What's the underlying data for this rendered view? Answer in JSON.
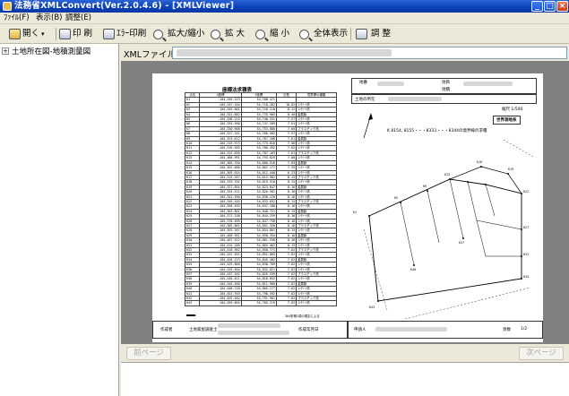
{
  "window": {
    "title": "法務省XMLConvert(Ver.2.0.4.6) - [XMLViewer]",
    "controls": {
      "minimize": "_",
      "maximize": "□",
      "close": "×"
    }
  },
  "menu": {
    "items": [
      {
        "label": "ﾌｧｲﾙ(F)"
      },
      {
        "label": "表示(B)"
      },
      {
        "label": "調整(E)"
      }
    ]
  },
  "toolbar": {
    "open_label": "開く",
    "print_label": "印 刷",
    "error_print_label": "ｴﾗｰ印刷",
    "zoom_toggle_label": "拡大/縮小",
    "zoom_in_label": "拡 大",
    "zoom_out_label": "縮 小",
    "fit_label": "全体表示",
    "adjust_label": "調 整"
  },
  "tree": {
    "root_label": "土地所在図-地積測量図"
  },
  "xml_file": {
    "label": "XMLファイル"
  },
  "document": {
    "table_title": "座標法求積表",
    "table_headers": [
      "点名",
      "X座標",
      "Y座標",
      "辺長",
      "境界標の種類"
    ],
    "table_rows": [
      [
        "K1",
        "-104,349.223",
        "34,708.471",
        "",
        ""
      ],
      [
        "K2",
        "-104,347.104",
        "34,718.262",
        "10.02",
        "ｺﾝｸﾘｰﾄ杭"
      ],
      [
        "K3",
        "-104,345.001",
        "34,726.110",
        "8.12",
        "ｺﾝｸﾘｰﾄ杭"
      ],
      [
        "K4",
        "-104,341.882",
        "34,733.905",
        "8.40",
        "金属鋲"
      ],
      [
        "K5",
        "-104,338.214",
        "34,740.531",
        "7.57",
        "ｺﾝｸﾘｰﾄ杭"
      ],
      [
        "K6",
        "-104,334.560",
        "34,747.209",
        "7.61",
        "ｺﾝｸﾘｰﾄ杭"
      ],
      [
        "K7",
        "-104,330.908",
        "34,753.880",
        "7.60",
        "プラスチック杭"
      ],
      [
        "K8",
        "-104,327.241",
        "34,760.502",
        "7.57",
        "ｺﾝｸﾘｰﾄ杭"
      ],
      [
        "K9",
        "-104,323.612",
        "34,767.188",
        "7.61",
        "金属鋲"
      ],
      [
        "K10",
        "-104,319.973",
        "34,773.816",
        "7.56",
        "ｺﾝｸﾘｰﾄ杭"
      ],
      [
        "K11",
        "-104,316.305",
        "34,780.492",
        "7.62",
        "ｺﾝｸﾘｰﾄ杭"
      ],
      [
        "K12",
        "-104,312.650",
        "34,787.163",
        "7.61",
        "プラスチック杭"
      ],
      [
        "K13",
        "-104,308.991",
        "34,793.829",
        "7.60",
        "ｺﾝｸﾘｰﾄ杭"
      ],
      [
        "K14",
        "-104,305.320",
        "34,800.516",
        "7.63",
        "金属鋲"
      ],
      [
        "K15",
        "-104,301.688",
        "34,807.177",
        "7.59",
        "ｺﾝｸﾘｰﾄ杭"
      ],
      [
        "K16",
        "-104,305.014",
        "34,812.440",
        "6.23",
        "ｺﾝｸﾘｰﾄ杭"
      ],
      [
        "K17",
        "-104,312.357",
        "34,815.982",
        "8.15",
        "プラスチック杭"
      ],
      [
        "K18",
        "-104,319.702",
        "34,819.510",
        "8.15",
        "ｺﾝｸﾘｰﾄ杭"
      ],
      [
        "K19",
        "-104,327.054",
        "34,823.047",
        "8.16",
        "金属鋲"
      ],
      [
        "K20",
        "-104,334.411",
        "34,826.581",
        "8.16",
        "ｺﾝｸﾘｰﾄ杭"
      ],
      [
        "K21",
        "-104,341.760",
        "34,830.120",
        "8.16",
        "ｺﾝｸﾘｰﾄ杭"
      ],
      [
        "K22",
        "-104,349.103",
        "34,833.652",
        "8.15",
        "プラスチック杭"
      ],
      [
        "K23",
        "-104,356.459",
        "34,837.186",
        "8.16",
        "ｺﾝｸﾘｰﾄ杭"
      ],
      [
        "K24",
        "-104,363.801",
        "34,840.721",
        "8.15",
        "金属鋲"
      ],
      [
        "K25",
        "-104,371.158",
        "34,844.259",
        "8.16",
        "ｺﾝｸﾘｰﾄ杭"
      ],
      [
        "K26",
        "-104,378.509",
        "34,847.790",
        "8.16",
        "ｺﾝｸﾘｰﾄ杭"
      ],
      [
        "K27",
        "-104,385.862",
        "34,851.328",
        "8.16",
        "プラスチック杭"
      ],
      [
        "K28",
        "-104,393.207",
        "34,854.861",
        "8.15",
        "ｺﾝｸﾘｰﾄ杭"
      ],
      [
        "K29",
        "-104,400.561",
        "34,858.394",
        "8.16",
        "金属鋲"
      ],
      [
        "K30",
        "-104,407.912",
        "34,861.930",
        "8.16",
        "ｺﾝｸﾘｰﾄ杭"
      ],
      [
        "K31",
        "-104,415.260",
        "34,865.462",
        "8.15",
        "ｺﾝｸﾘｰﾄ杭"
      ],
      [
        "K32",
        "-104,418.902",
        "34,858.771",
        "7.62",
        "プラスチック杭"
      ],
      [
        "K33",
        "-104,422.551",
        "34,852.083",
        "7.62",
        "ｺﾝｸﾘｰﾄ杭"
      ],
      [
        "K34",
        "-104,426.213",
        "34,845.402",
        "7.62",
        "金属鋲"
      ],
      [
        "K35",
        "-104,429.860",
        "34,838.709",
        "7.62",
        "ｺﾝｸﾘｰﾄ杭"
      ],
      [
        "K36",
        "-104,433.504",
        "34,832.021",
        "7.62",
        "ｺﾝｸﾘｰﾄ杭"
      ],
      [
        "K37",
        "-104,437.162",
        "34,825.339",
        "7.62",
        "プラスチック杭"
      ],
      [
        "K38",
        "-104,440.811",
        "34,818.652",
        "7.62",
        "ｺﾝｸﾘｰﾄ杭"
      ],
      [
        "K39",
        "-104,444.460",
        "34,811.960",
        "7.62",
        "金属鋲"
      ],
      [
        "K40",
        "-104,448.118",
        "34,805.277",
        "7.62",
        "ｺﾝｸﾘｰﾄ杭"
      ],
      [
        "K41",
        "-104,451.765",
        "34,798.592",
        "7.62",
        "ｺﾝｸﾘｰﾄ杭"
      ],
      [
        "K42",
        "-104,455.402",
        "34,791.901",
        "7.62",
        "プラスチック杭"
      ],
      [
        "K43",
        "-104,459.064",
        "34,785.219",
        "7.62",
        "ｺﾝｸﾘｰﾄ杭"
      ]
    ],
    "footer_note": "304条第2項の規定による",
    "right_header": [
      "地番",
      "地目",
      "地積"
    ],
    "location_label": "土地の所在",
    "scale_label": "縮尺 1/500",
    "box_label": "世界測地系",
    "plan_label": "K 8154, 8155・・・8333・・・8344の境界線の求積",
    "bottom": {
      "author_label": "作成者",
      "author_value": "土地家屋調査士",
      "date_label": "作成年月日",
      "applicant_label": "申請人",
      "page_label": "頁数",
      "page_value": "1/2"
    }
  },
  "nav": {
    "prev_label": "前ページ",
    "next_label": "次ページ"
  }
}
